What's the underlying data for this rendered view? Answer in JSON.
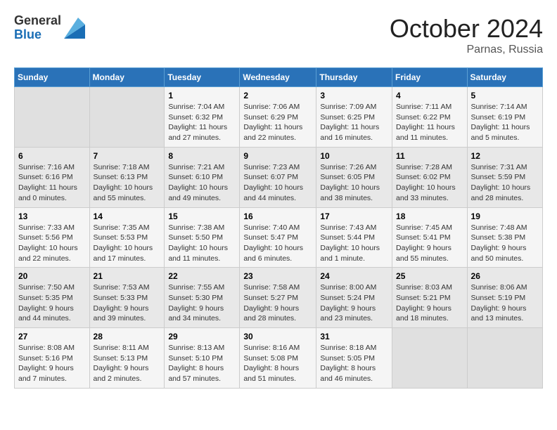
{
  "header": {
    "logo_general": "General",
    "logo_blue": "Blue",
    "month_title": "October 2024",
    "location": "Parnas, Russia"
  },
  "weekdays": [
    "Sunday",
    "Monday",
    "Tuesday",
    "Wednesday",
    "Thursday",
    "Friday",
    "Saturday"
  ],
  "weeks": [
    [
      null,
      null,
      {
        "day": "1",
        "sunrise": "Sunrise: 7:04 AM",
        "sunset": "Sunset: 6:32 PM",
        "daylight": "Daylight: 11 hours and 27 minutes."
      },
      {
        "day": "2",
        "sunrise": "Sunrise: 7:06 AM",
        "sunset": "Sunset: 6:29 PM",
        "daylight": "Daylight: 11 hours and 22 minutes."
      },
      {
        "day": "3",
        "sunrise": "Sunrise: 7:09 AM",
        "sunset": "Sunset: 6:25 PM",
        "daylight": "Daylight: 11 hours and 16 minutes."
      },
      {
        "day": "4",
        "sunrise": "Sunrise: 7:11 AM",
        "sunset": "Sunset: 6:22 PM",
        "daylight": "Daylight: 11 hours and 11 minutes."
      },
      {
        "day": "5",
        "sunrise": "Sunrise: 7:14 AM",
        "sunset": "Sunset: 6:19 PM",
        "daylight": "Daylight: 11 hours and 5 minutes."
      }
    ],
    [
      {
        "day": "6",
        "sunrise": "Sunrise: 7:16 AM",
        "sunset": "Sunset: 6:16 PM",
        "daylight": "Daylight: 11 hours and 0 minutes."
      },
      {
        "day": "7",
        "sunrise": "Sunrise: 7:18 AM",
        "sunset": "Sunset: 6:13 PM",
        "daylight": "Daylight: 10 hours and 55 minutes."
      },
      {
        "day": "8",
        "sunrise": "Sunrise: 7:21 AM",
        "sunset": "Sunset: 6:10 PM",
        "daylight": "Daylight: 10 hours and 49 minutes."
      },
      {
        "day": "9",
        "sunrise": "Sunrise: 7:23 AM",
        "sunset": "Sunset: 6:07 PM",
        "daylight": "Daylight: 10 hours and 44 minutes."
      },
      {
        "day": "10",
        "sunrise": "Sunrise: 7:26 AM",
        "sunset": "Sunset: 6:05 PM",
        "daylight": "Daylight: 10 hours and 38 minutes."
      },
      {
        "day": "11",
        "sunrise": "Sunrise: 7:28 AM",
        "sunset": "Sunset: 6:02 PM",
        "daylight": "Daylight: 10 hours and 33 minutes."
      },
      {
        "day": "12",
        "sunrise": "Sunrise: 7:31 AM",
        "sunset": "Sunset: 5:59 PM",
        "daylight": "Daylight: 10 hours and 28 minutes."
      }
    ],
    [
      {
        "day": "13",
        "sunrise": "Sunrise: 7:33 AM",
        "sunset": "Sunset: 5:56 PM",
        "daylight": "Daylight: 10 hours and 22 minutes."
      },
      {
        "day": "14",
        "sunrise": "Sunrise: 7:35 AM",
        "sunset": "Sunset: 5:53 PM",
        "daylight": "Daylight: 10 hours and 17 minutes."
      },
      {
        "day": "15",
        "sunrise": "Sunrise: 7:38 AM",
        "sunset": "Sunset: 5:50 PM",
        "daylight": "Daylight: 10 hours and 11 minutes."
      },
      {
        "day": "16",
        "sunrise": "Sunrise: 7:40 AM",
        "sunset": "Sunset: 5:47 PM",
        "daylight": "Daylight: 10 hours and 6 minutes."
      },
      {
        "day": "17",
        "sunrise": "Sunrise: 7:43 AM",
        "sunset": "Sunset: 5:44 PM",
        "daylight": "Daylight: 10 hours and 1 minute."
      },
      {
        "day": "18",
        "sunrise": "Sunrise: 7:45 AM",
        "sunset": "Sunset: 5:41 PM",
        "daylight": "Daylight: 9 hours and 55 minutes."
      },
      {
        "day": "19",
        "sunrise": "Sunrise: 7:48 AM",
        "sunset": "Sunset: 5:38 PM",
        "daylight": "Daylight: 9 hours and 50 minutes."
      }
    ],
    [
      {
        "day": "20",
        "sunrise": "Sunrise: 7:50 AM",
        "sunset": "Sunset: 5:35 PM",
        "daylight": "Daylight: 9 hours and 44 minutes."
      },
      {
        "day": "21",
        "sunrise": "Sunrise: 7:53 AM",
        "sunset": "Sunset: 5:33 PM",
        "daylight": "Daylight: 9 hours and 39 minutes."
      },
      {
        "day": "22",
        "sunrise": "Sunrise: 7:55 AM",
        "sunset": "Sunset: 5:30 PM",
        "daylight": "Daylight: 9 hours and 34 minutes."
      },
      {
        "day": "23",
        "sunrise": "Sunrise: 7:58 AM",
        "sunset": "Sunset: 5:27 PM",
        "daylight": "Daylight: 9 hours and 28 minutes."
      },
      {
        "day": "24",
        "sunrise": "Sunrise: 8:00 AM",
        "sunset": "Sunset: 5:24 PM",
        "daylight": "Daylight: 9 hours and 23 minutes."
      },
      {
        "day": "25",
        "sunrise": "Sunrise: 8:03 AM",
        "sunset": "Sunset: 5:21 PM",
        "daylight": "Daylight: 9 hours and 18 minutes."
      },
      {
        "day": "26",
        "sunrise": "Sunrise: 8:06 AM",
        "sunset": "Sunset: 5:19 PM",
        "daylight": "Daylight: 9 hours and 13 minutes."
      }
    ],
    [
      {
        "day": "27",
        "sunrise": "Sunrise: 8:08 AM",
        "sunset": "Sunset: 5:16 PM",
        "daylight": "Daylight: 9 hours and 7 minutes."
      },
      {
        "day": "28",
        "sunrise": "Sunrise: 8:11 AM",
        "sunset": "Sunset: 5:13 PM",
        "daylight": "Daylight: 9 hours and 2 minutes."
      },
      {
        "day": "29",
        "sunrise": "Sunrise: 8:13 AM",
        "sunset": "Sunset: 5:10 PM",
        "daylight": "Daylight: 8 hours and 57 minutes."
      },
      {
        "day": "30",
        "sunrise": "Sunrise: 8:16 AM",
        "sunset": "Sunset: 5:08 PM",
        "daylight": "Daylight: 8 hours and 51 minutes."
      },
      {
        "day": "31",
        "sunrise": "Sunrise: 8:18 AM",
        "sunset": "Sunset: 5:05 PM",
        "daylight": "Daylight: 8 hours and 46 minutes."
      },
      null,
      null
    ]
  ]
}
